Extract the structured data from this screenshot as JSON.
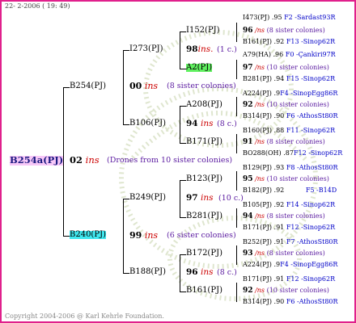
{
  "header": {
    "date": "22-  2-2006 ( 19: 49)"
  },
  "footer": {
    "copyright": "Copyright 2004-2006 @ Karl Kehrle Foundation."
  },
  "root": {
    "id": "B254a(PJ)",
    "num": "02",
    "ins": "ins",
    "note": "(Drones from 10 sister colonies)"
  },
  "gen1": [
    {
      "id": "B254(PJ)",
      "num": "00",
      "ins": "ins",
      "note": "(8 sister colonies)"
    },
    {
      "id": "B240(PJ)",
      "num": "99",
      "ins": "ins",
      "note": "(6 sister colonies)"
    }
  ],
  "gen2": [
    {
      "id": "I273(PJ)",
      "num": "98",
      "ins": "ins.",
      "note": "(1 c.)"
    },
    {
      "id": "B106(PJ)",
      "num": "94",
      "ins": "ins",
      "note": "(8 c.)"
    },
    {
      "id": "B249(PJ)",
      "num": "97",
      "ins": "ins",
      "note": "(10 c.)"
    },
    {
      "id": "B188(PJ)",
      "num": "96",
      "ins": "ins",
      "note": "(8 c.)"
    }
  ],
  "gen3": [
    "I152(PJ)",
    "A2(PJ)",
    "A208(PJ)",
    "B171(PJ)",
    "B123(PJ)",
    "B281(PJ)",
    "B172(PJ)",
    "B161(PJ)"
  ],
  "gen4": [
    {
      "top": {
        "id": "I473(PJ)",
        "val": ".95",
        "src": "F2 -Sardast93R"
      },
      "num": "96",
      "ins": "/ns",
      "note": "(8 sister colonies)",
      "bot": {
        "id": "B161(PJ)",
        "val": ".92",
        "src": "F13 -Sinop62R"
      }
    },
    {
      "top": {
        "id": "A79(HA)",
        "val": ".96",
        "src": "F0 -Çankiri97R"
      },
      "num": "97",
      "ins": "/ns",
      "note": "(10 sister colonies)",
      "bot": {
        "id": "B281(PJ)",
        "val": ".94",
        "src": "F15 -Sinop62R"
      }
    },
    {
      "top": {
        "id": "A224(PJ)",
        "val": ".9",
        "src": "F4 -SinopEgg86R"
      },
      "num": "92",
      "ins": "/ns",
      "note": "(10 sister colonies)",
      "bot": {
        "id": "B314(PJ)",
        "val": ".90",
        "src": "F6 -AthosSt80R"
      }
    },
    {
      "top": {
        "id": "B160(PJ)",
        "val": ".88",
        "src": "F11 -Sinop62R"
      },
      "num": "91",
      "ins": "/ns",
      "note": "(8 sister colonies)",
      "bot": {
        "id": "BO288(OH)",
        "val": ".87",
        "src": "F12 -Sinop62R"
      }
    },
    {
      "top": {
        "id": "B129(PJ)",
        "val": ".93",
        "src": "F8 -AthosSt80R"
      },
      "num": "95",
      "ins": "/ns",
      "note": "(10 sister colonies)",
      "bot": {
        "id": "B182(PJ)",
        "val": ".92",
        "src": "F5 -B14D"
      }
    },
    {
      "top": {
        "id": "B105(PJ)",
        "val": ".92",
        "src": "F14 -Sinop62R"
      },
      "num": "94",
      "ins": "/ns",
      "note": "(8 sister colonies)",
      "bot": {
        "id": "B171(PJ)",
        "val": ".91",
        "src": "F12 -Sinop62R"
      }
    },
    {
      "top": {
        "id": "B252(PJ)",
        "val": ".91",
        "src": "F7 -AthosSt80R"
      },
      "num": "93",
      "ins": "/ns",
      "note": "(8 sister colonies)",
      "bot": {
        "id": "A224(PJ)",
        "val": ".9",
        "src": "F4 -SinopEgg86R"
      }
    },
    {
      "top": {
        "id": "B171(PJ)",
        "val": ".91",
        "src": "F12 -Sinop62R"
      },
      "num": "92",
      "ins": "/ns",
      "note": "(10 sister colonies)",
      "bot": {
        "id": "B314(PJ)",
        "val": ".90",
        "src": "F6 -AthosSt80R"
      }
    }
  ]
}
